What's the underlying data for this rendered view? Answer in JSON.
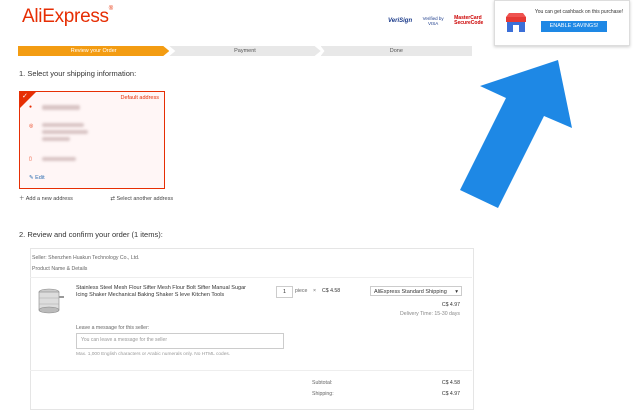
{
  "header": {
    "logo_text": "AliExpress",
    "logo_mark": "®",
    "badges": [
      "VeriSign",
      "Verified by VISA",
      "MasterCard SecureCode"
    ]
  },
  "steps": [
    "Review your Order",
    "Payment",
    "Done"
  ],
  "section1": {
    "title": "1. Select your shipping information:",
    "address": {
      "default_label": "Default address",
      "edit_label": "Edit"
    },
    "add_address": "Add a new address",
    "select_address": "Select another address"
  },
  "section2": {
    "title": "2. Review and confirm your order (1 items):",
    "seller": "Seller: Shenzhen Huakun Technology Co., Ltd.",
    "product_header": "Product Name & Details",
    "product_name": "Stainless Steel Mesh Flour Sifter Mesh Flour Bolt Sifter Manual Sugar Icing Shaker Mechanical Baking Shaker S leve Kitchen Tools",
    "quantity": "1",
    "unit": "piece",
    "times": "×",
    "unit_price": "C$ 4.58",
    "shipping_method": "AliExpress Standard Shipping",
    "shipping_price": "C$ 4.97",
    "delivery_time": "Delivery Time: 15-30 days",
    "message_label": "Leave a message for this seller:",
    "message_placeholder": "You can leave a message for the seller",
    "message_hint": "Max. 1,000 English characters or Arabic numerals only. No HTML codes.",
    "subtotal_label": "Subtotal:",
    "subtotal_value": "C$ 4.58",
    "shipping_label": "Shipping:",
    "shipping_value": "C$ 4.97"
  },
  "popup": {
    "text": "You can get cashback on this purchase!",
    "button": "ENABLE SAVINGS!"
  },
  "colors": {
    "accent": "#e62e04",
    "step_active": "#f39c12",
    "arrow": "#1e88e5",
    "button": "#1e88e5"
  }
}
